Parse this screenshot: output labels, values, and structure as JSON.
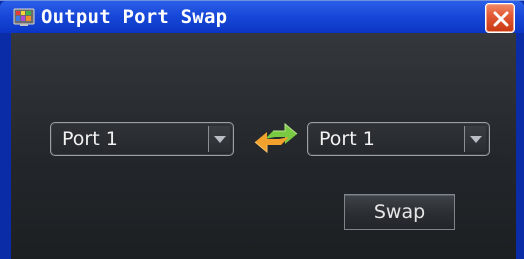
{
  "window": {
    "title": "Output Port Swap",
    "icon": "app-palette-icon",
    "close_icon": "close-icon"
  },
  "left_port": {
    "selected": "Port 1",
    "arrow_icon": "chevron-down-icon"
  },
  "right_port": {
    "selected": "Port 1",
    "arrow_icon": "chevron-down-icon"
  },
  "swap_arrows_icon": "swap-arrows-icon",
  "swap_button": {
    "label": "Swap"
  },
  "colors": {
    "titlebar": "#1848d9",
    "close": "#e35b35",
    "arrow_green": "#7ac943",
    "arrow_orange": "#f2a22c",
    "panel": "#23272b"
  }
}
